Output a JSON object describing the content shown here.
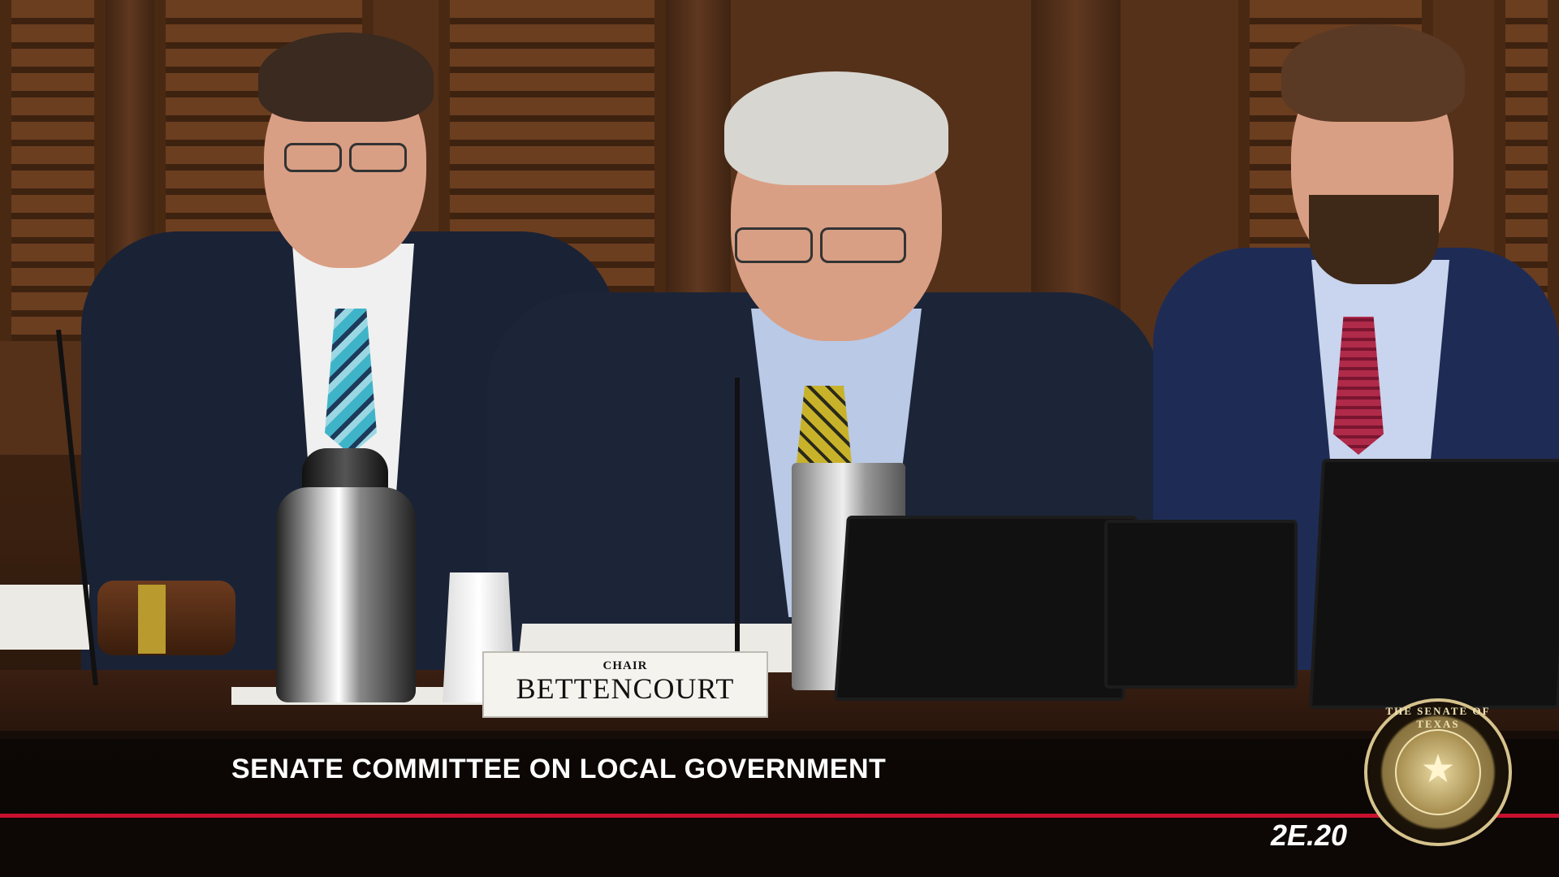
{
  "nameplate": {
    "title": "CHAIR",
    "name": "BETTENCOURT"
  },
  "lower_third": {
    "caption": "SENATE COMMITTEE ON LOCAL GOVERNMENT"
  },
  "room_code": "2E.20",
  "seal": {
    "text": "THE SENATE OF TEXAS",
    "star": "★"
  },
  "colors": {
    "accent_rule": "#c8102e",
    "caption_text": "#ffffff"
  }
}
